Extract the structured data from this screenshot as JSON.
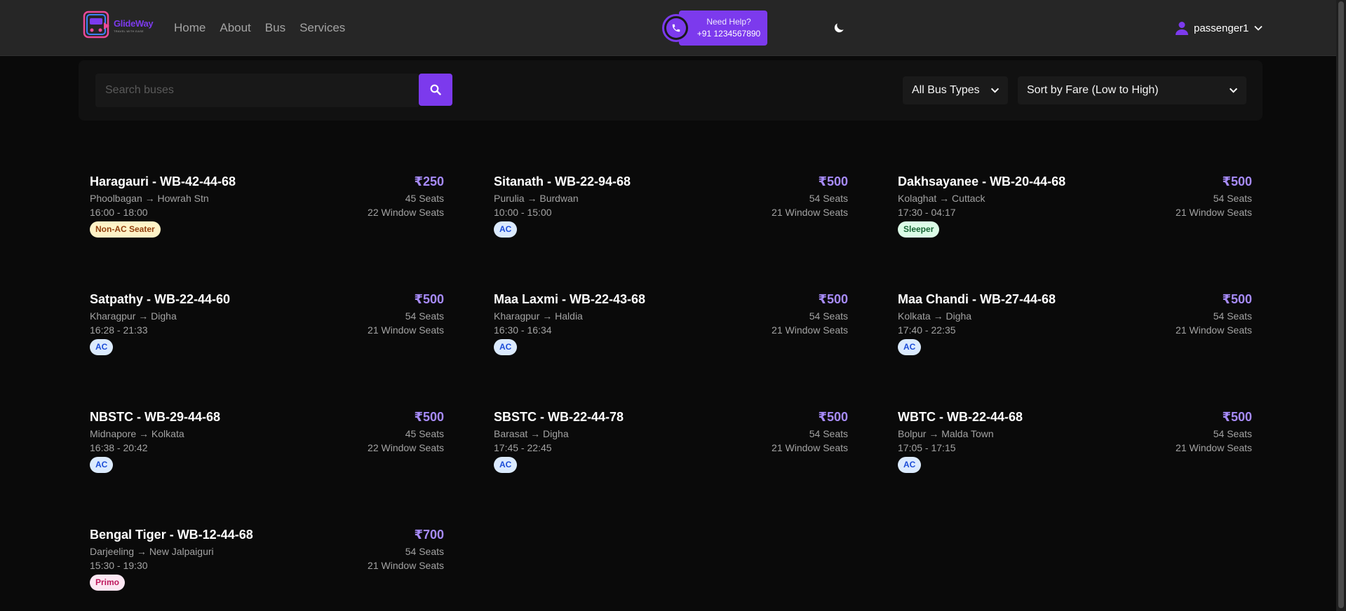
{
  "brand": {
    "name": "GlideWay",
    "tagline": "TRAVEL WITH EASE",
    "accent_color": "#7c3aed"
  },
  "nav": {
    "links": [
      "Home",
      "About",
      "Bus",
      "Services"
    ]
  },
  "help": {
    "title": "Need Help?",
    "phone": "+91 1234567890",
    "icon": "phone-icon"
  },
  "theme_toggle": {
    "icon": "moon-icon"
  },
  "user": {
    "name": "passenger1",
    "icon": "user-icon"
  },
  "search": {
    "placeholder": "Search buses",
    "value": "",
    "button_icon": "search-icon"
  },
  "filters": {
    "bus_type": "All Bus Types",
    "sort": "Sort by Fare (Low to High)"
  },
  "buses": [
    {
      "name": "Haragauri - WB-42-44-68",
      "route": "Phoolbagan → Howrah Stn",
      "time": "16:00 - 18:00",
      "type": "Non-AC Seater",
      "fare": "₹250",
      "seats": "45 Seats",
      "window_seats": "22 Window Seats"
    },
    {
      "name": "Sitanath - WB-22-94-68",
      "route": "Purulia → Burdwan",
      "time": "10:00 - 15:00",
      "type": "AC",
      "fare": "₹500",
      "seats": "54 Seats",
      "window_seats": "21 Window Seats"
    },
    {
      "name": "Dakhsayanee - WB-20-44-68",
      "route": "Kolaghat → Cuttack",
      "time": "17:30 - 04:17",
      "type": "Sleeper",
      "fare": "₹500",
      "seats": "54 Seats",
      "window_seats": "21 Window Seats"
    },
    {
      "name": "Satpathy - WB-22-44-60",
      "route": "Kharagpur → Digha",
      "time": "16:28 - 21:33",
      "type": "AC",
      "fare": "₹500",
      "seats": "54 Seats",
      "window_seats": "21 Window Seats"
    },
    {
      "name": "Maa Laxmi - WB-22-43-68",
      "route": "Kharagpur → Haldia",
      "time": "16:30 - 16:34",
      "type": "AC",
      "fare": "₹500",
      "seats": "54 Seats",
      "window_seats": "21 Window Seats"
    },
    {
      "name": "Maa Chandi - WB-27-44-68",
      "route": "Kolkata → Digha",
      "time": "17:40 - 22:35",
      "type": "AC",
      "fare": "₹500",
      "seats": "54 Seats",
      "window_seats": "21 Window Seats"
    },
    {
      "name": "NBSTC - WB-29-44-68",
      "route": "Midnapore → Kolkata",
      "time": "16:38 - 20:42",
      "type": "AC",
      "fare": "₹500",
      "seats": "45 Seats",
      "window_seats": "22 Window Seats"
    },
    {
      "name": "SBSTC - WB-22-44-78",
      "route": "Barasat → Digha",
      "time": "17:45 - 22:45",
      "type": "AC",
      "fare": "₹500",
      "seats": "54 Seats",
      "window_seats": "21 Window Seats"
    },
    {
      "name": "WBTC - WB-22-44-68",
      "route": "Bolpur → Malda Town",
      "time": "17:05 - 17:15",
      "type": "AC",
      "fare": "₹500",
      "seats": "54 Seats",
      "window_seats": "21 Window Seats"
    },
    {
      "name": "Bengal Tiger - WB-12-44-68",
      "route": "Darjeeling → New Jalpaiguri",
      "time": "15:30 - 19:30",
      "type": "Primo",
      "fare": "₹700",
      "seats": "54 Seats",
      "window_seats": "21 Window Seats"
    }
  ]
}
